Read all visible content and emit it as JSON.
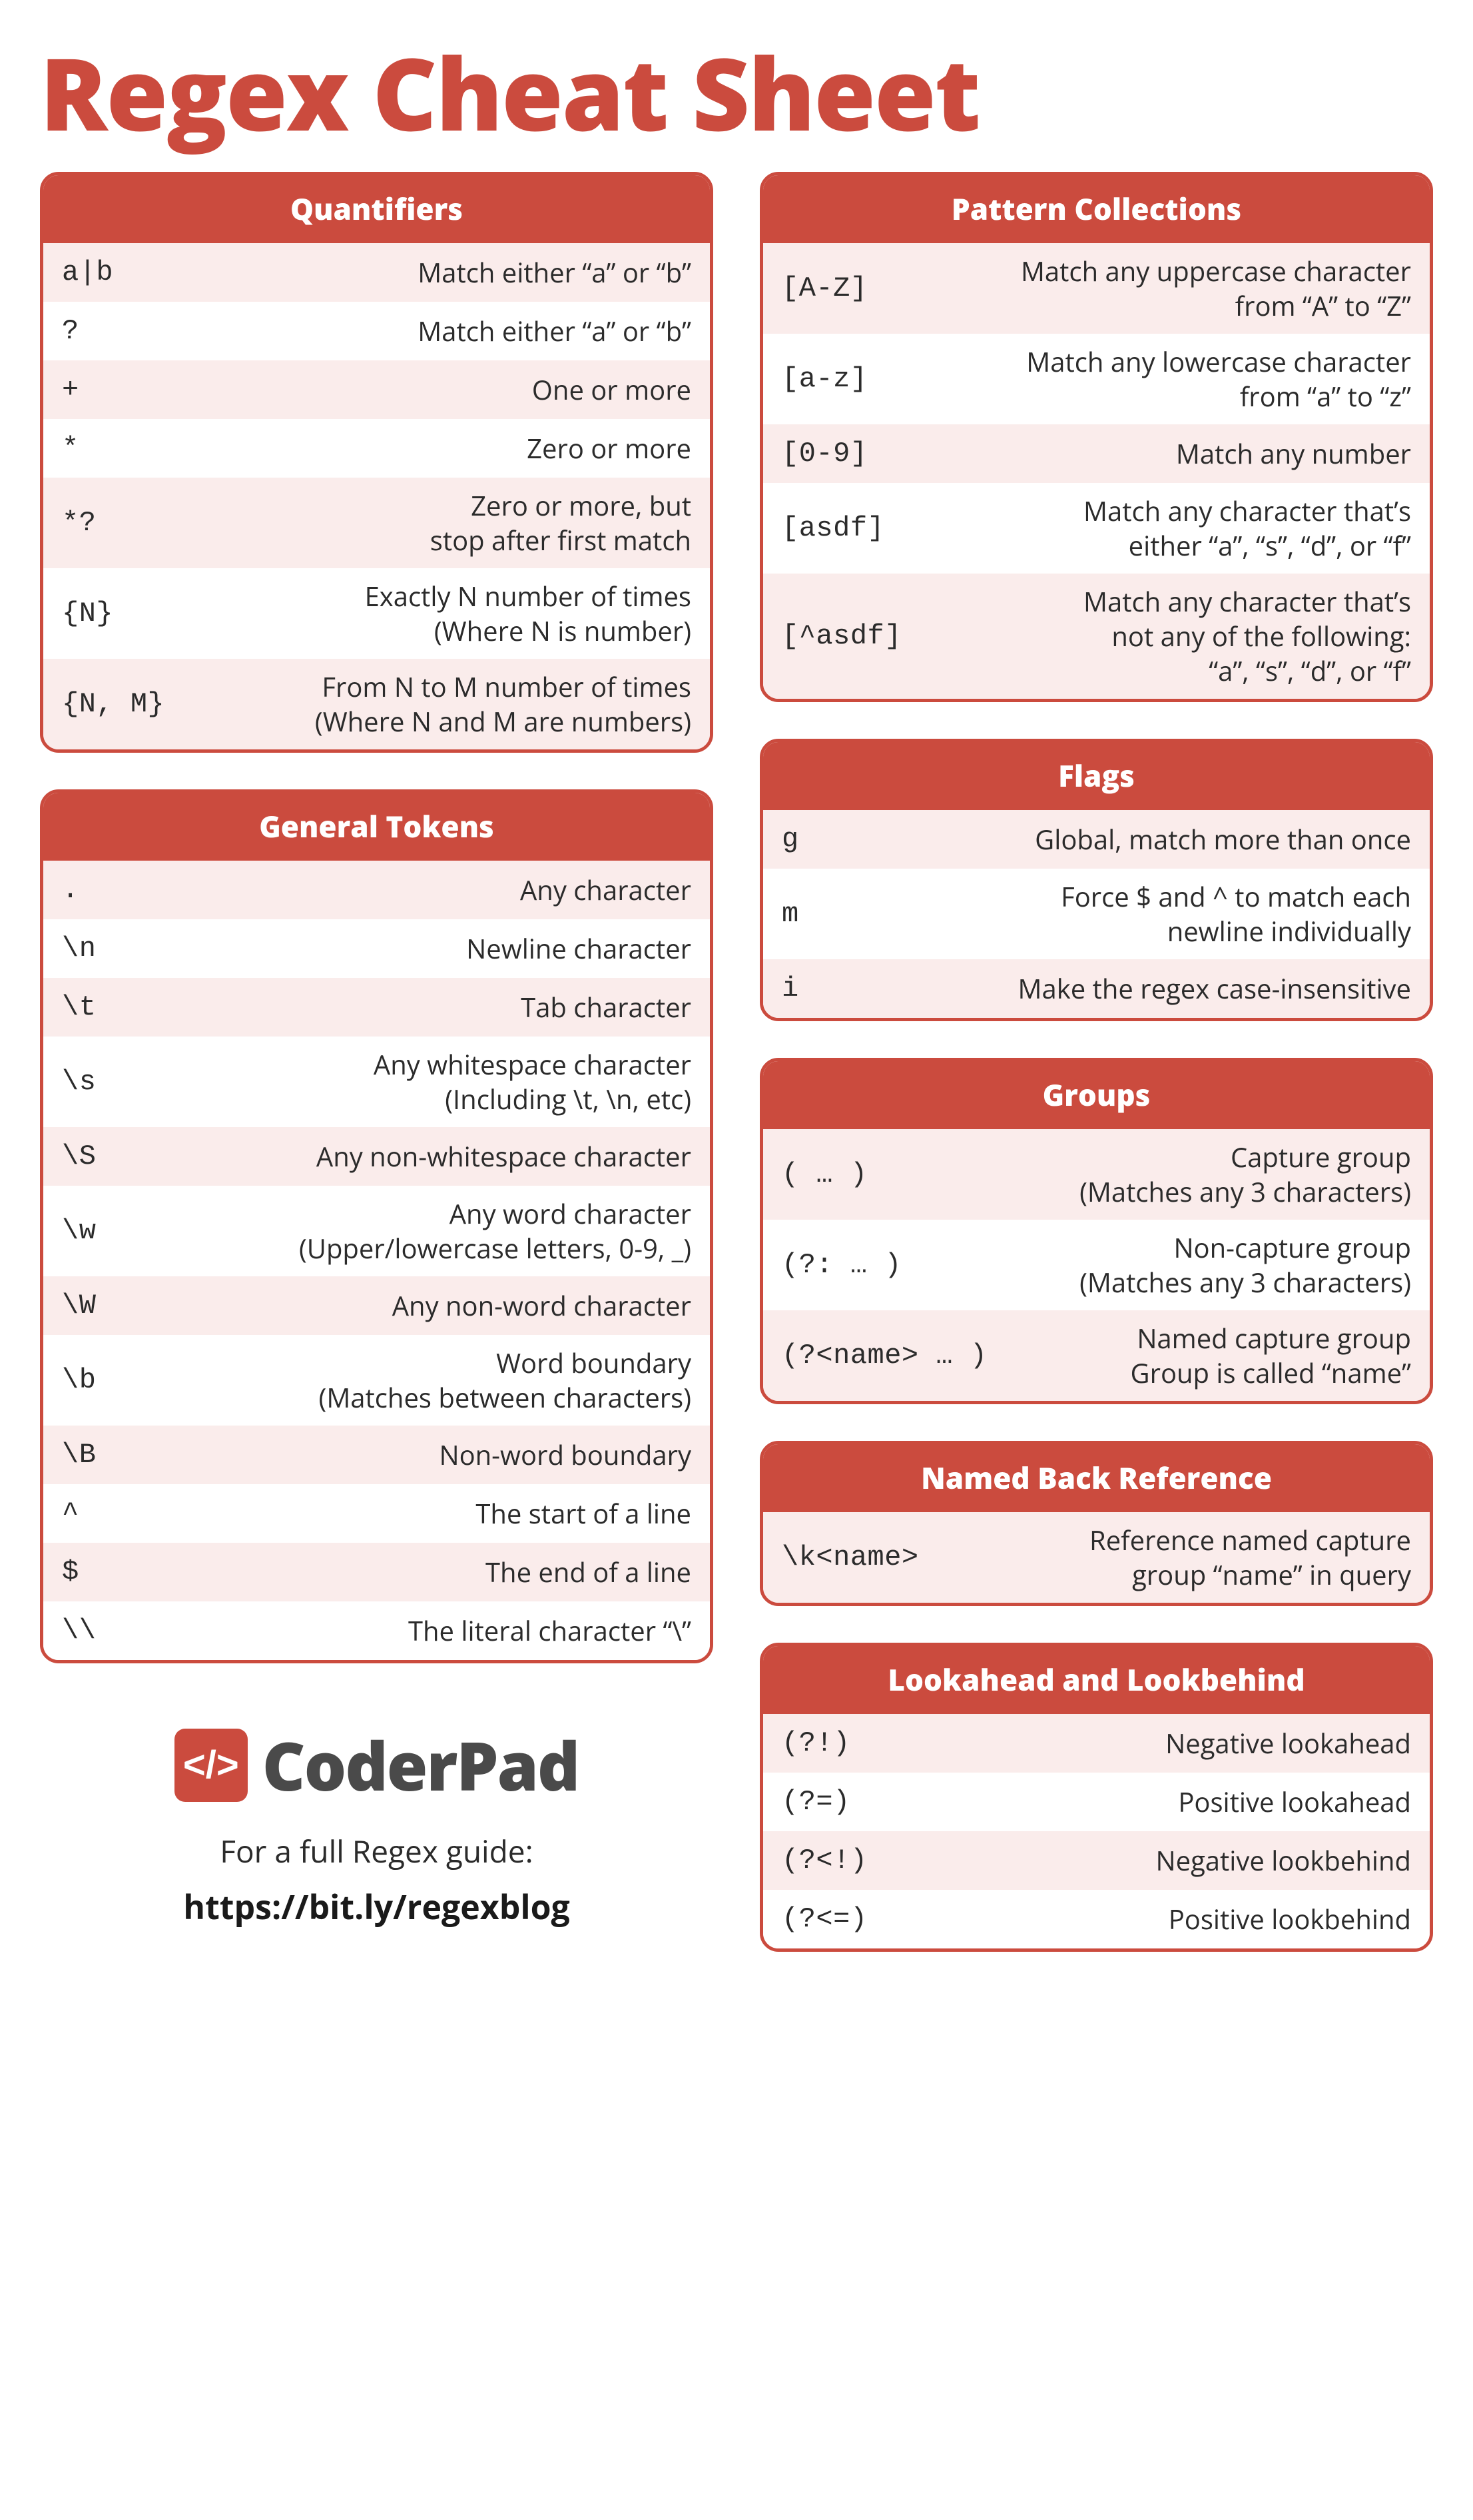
{
  "title": "Regex Cheat Sheet",
  "sections": {
    "quantifiers": {
      "title": "Quantifiers",
      "rows": [
        {
          "token": "a|b",
          "desc": [
            "Match either “a” or “b”"
          ]
        },
        {
          "token": "?",
          "desc": [
            "Match either “a” or “b”"
          ]
        },
        {
          "token": "+",
          "desc": [
            "One or more"
          ]
        },
        {
          "token": "*",
          "desc": [
            "Zero or more"
          ]
        },
        {
          "token": "*?",
          "desc": [
            "Zero or more, but",
            "stop after first match"
          ]
        },
        {
          "token": "{N}",
          "desc": [
            "Exactly N number of times",
            "(Where N is number)"
          ]
        },
        {
          "token": "{N, M}",
          "desc": [
            "From N to M number of times",
            "(Where N and M are numbers)"
          ]
        }
      ]
    },
    "general_tokens": {
      "title": "General Tokens",
      "rows": [
        {
          "token": ".",
          "desc": [
            "Any character"
          ]
        },
        {
          "token": "\\n",
          "desc": [
            "Newline character"
          ]
        },
        {
          "token": "\\t",
          "desc": [
            "Tab character"
          ]
        },
        {
          "token": "\\s",
          "desc": [
            "Any whitespace character",
            "(Including \\t, \\n, etc)"
          ]
        },
        {
          "token": "\\S",
          "desc": [
            "Any non-whitespace character"
          ]
        },
        {
          "token": "\\w",
          "desc": [
            "Any word character",
            "(Upper/lowercase letters, 0-9, _)"
          ]
        },
        {
          "token": "\\W",
          "desc": [
            "Any non-word character"
          ]
        },
        {
          "token": "\\b",
          "desc": [
            "Word boundary",
            "(Matches between characters)"
          ]
        },
        {
          "token": "\\B",
          "desc": [
            "Non-word boundary"
          ]
        },
        {
          "token": "^",
          "desc": [
            "The start of a line"
          ]
        },
        {
          "token": "$",
          "desc": [
            "The end of a line"
          ]
        },
        {
          "token": "\\\\",
          "desc": [
            "The literal character “\\”"
          ]
        }
      ]
    },
    "pattern_collections": {
      "title": "Pattern Collections",
      "rows": [
        {
          "token": "[A-Z]",
          "desc": [
            "Match any uppercase character",
            "from “A” to “Z”"
          ]
        },
        {
          "token": "[a-z]",
          "desc": [
            "Match any lowercase character",
            "from “a” to “z”"
          ]
        },
        {
          "token": "[0-9]",
          "desc": [
            "Match any number"
          ]
        },
        {
          "token": "[asdf]",
          "desc": [
            "Match any character that’s",
            "either “a”, “s”, “d”, or “f”"
          ]
        },
        {
          "token": "[^asdf]",
          "desc": [
            "Match any character that’s",
            "not any of the following:",
            "“a”, “s”, “d”, or “f”"
          ]
        }
      ]
    },
    "flags": {
      "title": "Flags",
      "rows": [
        {
          "token": "g",
          "desc": [
            "Global, match more than once"
          ]
        },
        {
          "token": "m",
          "desc": [
            "Force $ and ^ to match each",
            "newline individually"
          ]
        },
        {
          "token": "i",
          "desc": [
            "Make the regex case-insensitive"
          ]
        }
      ]
    },
    "groups": {
      "title": "Groups",
      "rows": [
        {
          "token": "( … )",
          "desc": [
            "Capture group",
            "(Matches any 3 characters)"
          ]
        },
        {
          "token": "(?: … )",
          "desc": [
            "Non-capture group",
            "(Matches any 3 characters)"
          ]
        },
        {
          "token": "(?<name> … )",
          "desc": [
            "Named capture group",
            "Group is called “name”"
          ]
        }
      ]
    },
    "named_backref": {
      "title": "Named Back Reference",
      "rows": [
        {
          "token": "\\k<name>",
          "desc": [
            "Reference named capture",
            "group “name” in query"
          ]
        }
      ]
    },
    "lookaround": {
      "title": "Lookahead and Lookbehind",
      "rows": [
        {
          "token": "(?!)",
          "desc": [
            "Negative lookahead"
          ]
        },
        {
          "token": "(?=)",
          "desc": [
            "Positive lookahead"
          ]
        },
        {
          "token": "(?<!)",
          "desc": [
            "Negative lookbehind"
          ]
        },
        {
          "token": "(?<=)",
          "desc": [
            "Positive lookbehind"
          ]
        }
      ]
    }
  },
  "footer": {
    "brand_glyph": "</>",
    "brand_name": "CoderPad",
    "lead": "For a full Regex guide:",
    "link": "https://bit.ly/regexblog"
  }
}
